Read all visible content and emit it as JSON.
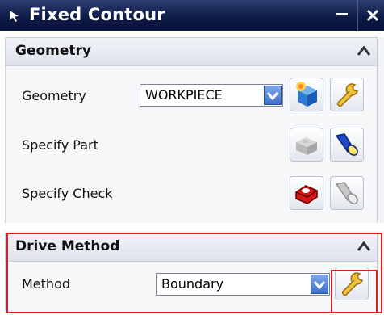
{
  "window": {
    "title": "Fixed Contour"
  },
  "sections": {
    "geometry": {
      "title": "Geometry",
      "rows": {
        "geometry": {
          "label": "Geometry",
          "value": "WORKPIECE"
        },
        "specify_part": {
          "label": "Specify Part"
        },
        "specify_check": {
          "label": "Specify Check"
        }
      }
    },
    "drive_method": {
      "title": "Drive Method",
      "rows": {
        "method": {
          "label": "Method",
          "value": "Boundary"
        }
      }
    }
  },
  "icons": {
    "title_arrow": "arrow-cursor-icon",
    "minimize": "minimize-icon",
    "close": "close-icon",
    "collapse": "chevron-up-icon",
    "new_geometry": "new-workpiece-icon",
    "edit": "wrench-icon",
    "select_part": "part-select-icon",
    "display_part": "flashlight-icon",
    "select_check": "check-geometry-icon",
    "display_check": "flashlight-icon"
  },
  "colors": {
    "titlebar": "#0e1b47",
    "highlight": "#d82020",
    "combo_arrow": "#3b6fcd"
  }
}
